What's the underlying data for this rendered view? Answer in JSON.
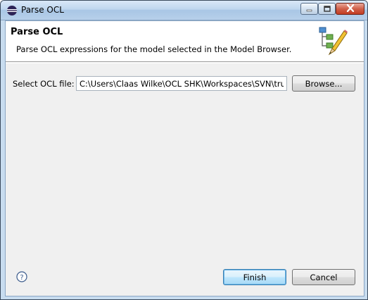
{
  "window": {
    "title": "Parse OCL"
  },
  "header": {
    "title": "Parse OCL",
    "description": "Parse OCL expressions for the model selected in the Model Browser."
  },
  "form": {
    "file_label": "Select OCL file:",
    "file_value": "C:\\Users\\Claas Wilke\\OCL SHK\\Workspaces\\SVN\\trunk",
    "browse_label": "Browse..."
  },
  "footer": {
    "finish_label": "Finish",
    "cancel_label": "Cancel"
  },
  "icons": {
    "app": "eclipse-icon",
    "wizard": "ocl-wizard-pencil-icon",
    "help": "help-icon"
  }
}
